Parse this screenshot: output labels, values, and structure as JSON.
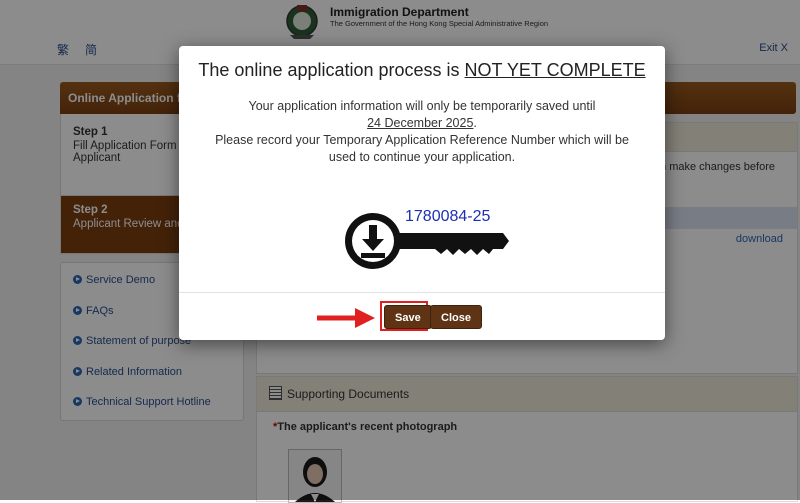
{
  "header": {
    "title": "Immigration Department",
    "subtitle": "The Government of the Hong Kong Special Administrative Region",
    "lang_traditional": "繁",
    "lang_simplified": "简",
    "exit": "Exit X"
  },
  "sidebar": {
    "heading": "Online Application f",
    "steps": [
      {
        "title": "Step 1",
        "desc": "Fill Application Form",
        "desc2": "Applicant"
      },
      {
        "title": "Step 2",
        "desc": "Applicant Review and"
      }
    ],
    "links": [
      "Service Demo",
      "FAQs",
      "Statement of purpose",
      "Related Information",
      "Technical Support Hotline"
    ]
  },
  "main": {
    "changes_text": "n make changes before",
    "download": "download",
    "supporting_title": "Supporting Documents",
    "photo_label": "The applicant's recent photograph",
    "required_mark": "*"
  },
  "modal": {
    "title_prefix": "The online application process is ",
    "title_emph": "NOT YET COMPLETE",
    "line1": "Your application information will only be temporarily saved until",
    "date": "24 December 2025",
    "period": ".",
    "line2": "Please record your Temporary Application Reference Number which will be",
    "line3": "used to continue your application.",
    "reference_number": "1780084-25",
    "save_label": "Save",
    "close_label": "Close"
  },
  "colors": {
    "brand_brown": "#7a3f12",
    "button_brown": "#5e3414",
    "highlight_red": "#e02020",
    "reference_blue": "#1d2fb0"
  }
}
